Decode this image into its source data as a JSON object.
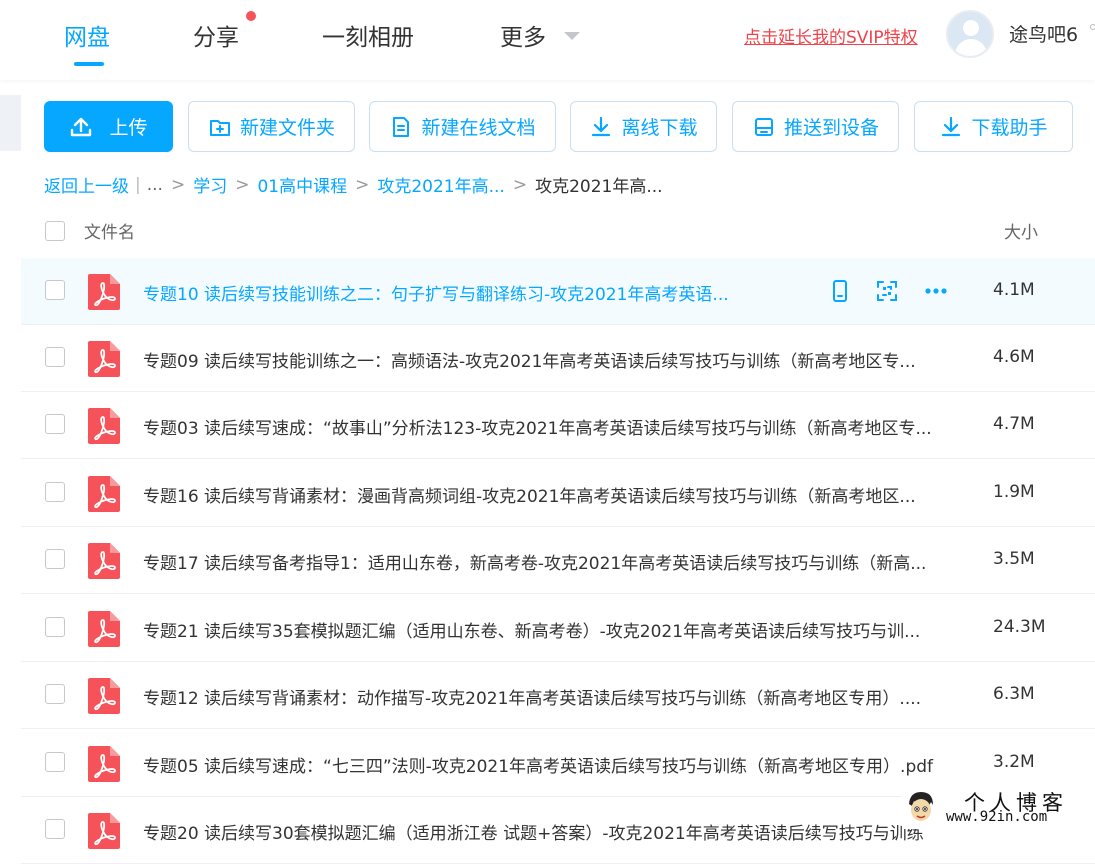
{
  "header": {
    "nav": [
      {
        "label": "网盘",
        "active": true
      },
      {
        "label": "分享",
        "has_badge": true
      },
      {
        "label": "一刻相册"
      },
      {
        "label": "更多",
        "has_dropdown": true
      }
    ],
    "svip_link": "点击延长我的SVIP特权",
    "username": "途鸟吧6"
  },
  "toolbar": {
    "upload": "上传",
    "new_folder": "新建文件夹",
    "new_doc": "新建在线文档",
    "offline_download": "离线下载",
    "push_device": "推送到设备",
    "download_helper": "下载助手"
  },
  "breadcrumb": {
    "back": "返回上一级",
    "ellipsis": "...",
    "items": [
      "学习",
      "01高中课程",
      "攻克2021年高..."
    ],
    "current": "攻克2021年高..."
  },
  "table": {
    "col_name": "文件名",
    "col_size": "大小",
    "rows": [
      {
        "name": "专题10 读后续写技能训练之二：句子扩写与翻译练习-攻克2021年高考英语...",
        "size": "4.1M",
        "hover": true
      },
      {
        "name": "专题09 读后续写技能训练之一：高频语法-攻克2021年高考英语读后续写技巧与训练（新高考地区专...",
        "size": "4.6M"
      },
      {
        "name": "专题03 读后续写速成：“故事山”分析法123-攻克2021年高考英语读后续写技巧与训练（新高考地区专...",
        "size": "4.7M"
      },
      {
        "name": "专题16 读后续写背诵素材：漫画背高频词组-攻克2021年高考英语读后续写技巧与训练（新高考地区...",
        "size": "1.9M"
      },
      {
        "name": "专题17 读后续写备考指导1：适用山东卷，新高考卷-攻克2021年高考英语读后续写技巧与训练（新高...",
        "size": "3.5M"
      },
      {
        "name": "专题21 读后续写35套模拟题汇编（适用山东卷、新高考卷）-攻克2021年高考英语读后续写技巧与训...",
        "size": "24.3M"
      },
      {
        "name": "专题12 读后续写背诵素材：动作描写-攻克2021年高考英语读后续写技巧与训练（新高考地区专用）....",
        "size": "6.3M"
      },
      {
        "name": "专题05 读后续写速成：“七三四”法则-攻克2021年高考英语读后续写技巧与训练（新高考地区专用）.pdf",
        "size": "3.2M"
      },
      {
        "name": "专题20 读后续写30套模拟题汇编（适用浙江卷 试题+答案）-攻克2021年高考英语读后续写技巧与训练",
        "size": ""
      }
    ]
  },
  "watermark": {
    "cn": "个人博客",
    "url": "www.92in.com"
  },
  "colors": {
    "accent": "#06a7ff",
    "svip": "#f0424a",
    "pdf": "#f5525a"
  }
}
